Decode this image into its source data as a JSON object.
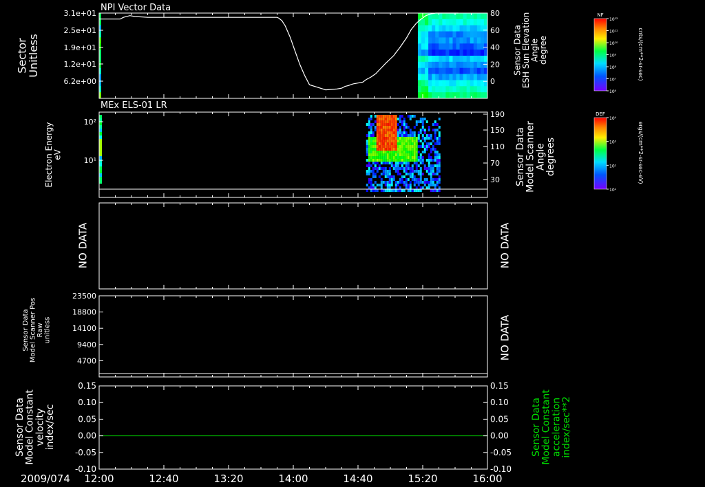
{
  "time_axis": {
    "date": "2009/074",
    "ticks": [
      "12:00",
      "12:40",
      "13:20",
      "14:00",
      "14:40",
      "15:20",
      "16:00"
    ],
    "range_minutes": [
      0,
      240
    ]
  },
  "colors": {
    "background": "#000000",
    "frame": "#ffffff",
    "line": "#ffffff",
    "accel_line": "#00cc00",
    "accel_label": "#00dd00"
  },
  "chart_data": [
    {
      "type": "heatmap",
      "title": "NPI Vector Data",
      "ylabel": [
        "Sector",
        "Unitless"
      ],
      "y_ticks": [
        "3.1e+01",
        "2.5e+01",
        "1.9e+01",
        "1.2e+01",
        "6.2e+00"
      ],
      "right_label": [
        "Sensor Data",
        "ESH Sun Elevation",
        "Angle",
        "degree"
      ],
      "right_ticks": [
        "80",
        "60",
        "40",
        "20",
        "0"
      ],
      "right_range": [
        -20,
        80
      ],
      "colorbar": {
        "title": "NF",
        "ticks": [
          "10¹²",
          "10¹¹",
          "10¹⁰",
          "10⁹",
          "10⁸",
          "10⁷",
          "10⁶"
        ],
        "unit": "cnts/(cm**2-sr-sec)"
      },
      "data_windows_minutes": [
        [
          0,
          1
        ],
        [
          197,
          240
        ]
      ],
      "sun_elevation_series": {
        "x_minutes": [
          0,
          8,
          13,
          15,
          19,
          22,
          30,
          60,
          90,
          100,
          103,
          105,
          108,
          110,
          111,
          113,
          115,
          118,
          121,
          124,
          127,
          130,
          140,
          147,
          150,
          152,
          154,
          157,
          160,
          163,
          165,
          168,
          171,
          174,
          177,
          182,
          186,
          190,
          193,
          196,
          199,
          202,
          205,
          208,
          211,
          214,
          218,
          222
        ],
        "y_degrees": [
          73,
          73,
          73,
          75,
          77,
          76,
          75,
          75,
          75,
          75,
          75,
          75,
          75,
          75,
          74,
          71,
          65,
          52,
          36,
          20,
          7,
          -4,
          -10,
          -9,
          -8,
          -6,
          -5,
          -3,
          -2,
          -1,
          2,
          5,
          9,
          15,
          21,
          30,
          40,
          51,
          61,
          68,
          73,
          77,
          79,
          80,
          80,
          80,
          80,
          80
        ]
      }
    },
    {
      "type": "heatmap",
      "title": "MEx ELS-01 LR",
      "ylabel": [
        "Electron Energy",
        "eV"
      ],
      "y_ticks": [
        "10²",
        "10¹"
      ],
      "right_label": [
        "Sensor Data",
        "Model Scanner",
        "Angle",
        "degrees"
      ],
      "right_ticks": [
        "190",
        "150",
        "110",
        "70",
        "30"
      ],
      "colorbar": {
        "title": "DEF",
        "ticks": [
          "10⁴",
          "10³",
          "10²",
          "10¹"
        ],
        "unit": "ergs/(cm**2-sr-sec-eV)"
      },
      "data_windows_minutes": [
        [
          0,
          2
        ],
        [
          165,
          210
        ]
      ],
      "scanner_angle_level": 10
    },
    {
      "type": "line",
      "ylabel": [
        "NO DATA"
      ],
      "right_label": [
        "NO DATA"
      ]
    },
    {
      "type": "line",
      "ylabel": [
        "Sensor Data",
        "Model Scanner Pos",
        "Raw",
        "unitless"
      ],
      "y_ticks": [
        "23500",
        "18800",
        "14100",
        "9400",
        "4700"
      ],
      "ylim": [
        0,
        23500
      ],
      "right_label": [
        "NO DATA"
      ],
      "scanner_pos_level": 900
    },
    {
      "type": "line",
      "ylabel": [
        "Sensor Data",
        "Model Constant",
        "velocity",
        "index/sec"
      ],
      "y_ticks": [
        "0.15",
        "0.10",
        "0.05",
        "0.00",
        "-0.05",
        "-0.10"
      ],
      "ylim": [
        -0.1,
        0.15
      ],
      "right_label": [
        "Sensor Data",
        "Model Constant",
        "acceleration",
        "index/sec**2"
      ],
      "right_ticks": [
        "0.15",
        "0.10",
        "0.05",
        "0.00",
        "-0.05",
        "-0.10"
      ],
      "series": [
        {
          "x_minutes": [
            0,
            240
          ],
          "values": [
            0.0,
            0.0
          ]
        }
      ]
    }
  ]
}
